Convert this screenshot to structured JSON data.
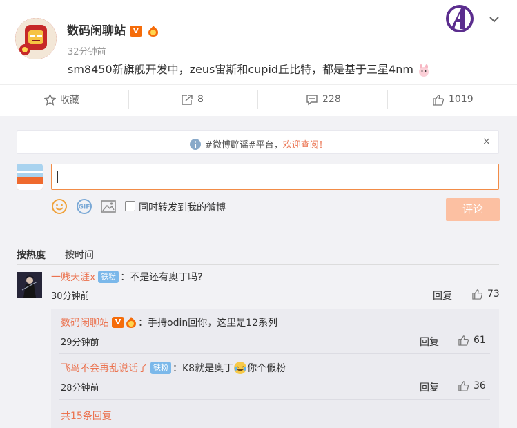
{
  "post": {
    "author": "数码闲聊站",
    "verified_badge": "V",
    "time": "32分钟前",
    "content": "sm8450新旗舰开发中，zeus宙斯和cupid丘比特，都是基于三星4nm",
    "avatar_icon": "ironman-avatar",
    "logo_icon": "avengers-logo-icon"
  },
  "actions": {
    "favorite": "收藏",
    "repost_count": "8",
    "comment_count": "228",
    "like_count": "1019"
  },
  "notice": {
    "text": "#微博辟谣#平台，",
    "link": "欢迎查阅！",
    "close": "×"
  },
  "composer": {
    "sync_label": "同时转发到我的微博",
    "submit_label": "评论"
  },
  "sort": {
    "hot": "按热度",
    "time": "按时间"
  },
  "comments": [
    {
      "user": "一贱天涯x",
      "fan_badge": "铁粉",
      "text": "：不是还有奥丁吗?",
      "time": "30分钟前",
      "reply": "回复",
      "likes": "73"
    }
  ],
  "replies": [
    {
      "user": "数码闲聊站",
      "badge": "V",
      "text": "：手持odin回你，这里是12系列",
      "time": "29分钟前",
      "reply": "回复",
      "likes": "61"
    },
    {
      "user": "飞鸟不会再乱说话了",
      "fan_badge": "铁粉",
      "text_before": "：K8就是奥丁",
      "text_after": "你个假粉",
      "time": "28分钟前",
      "reply": "回复",
      "likes": "36"
    }
  ],
  "more_replies": "共15条回复",
  "colors": {
    "accent": "#eb7350",
    "input_border": "#f28c47",
    "submit_bg": "#fcc0a2",
    "fan_badge": "#7bb8ea",
    "gray_bg": "#f2f2f5"
  }
}
